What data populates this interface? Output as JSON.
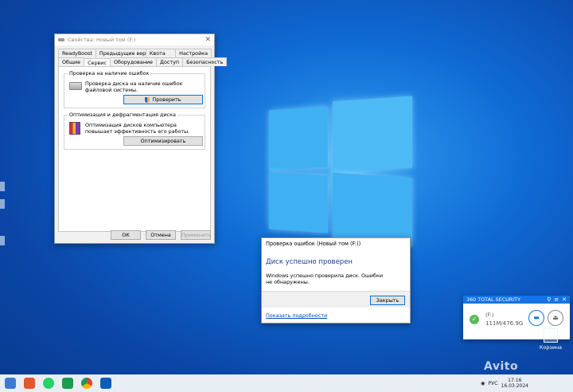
{
  "properties_window": {
    "title": "Свойства: Новый том (F:)",
    "tabs_row1": [
      "ReadyBoost",
      "Предыдущие версии",
      "Квота",
      "Настройка"
    ],
    "tabs_row2": [
      "Общие",
      "Сервис",
      "Оборудование",
      "Доступ",
      "Безопасность"
    ],
    "active_tab": "Сервис",
    "error_check": {
      "legend": "Проверка на наличие ошибок",
      "text": "Проверка диска на наличие ошибок файловой системы.",
      "button": "Проверить"
    },
    "optimize": {
      "legend": "Оптимизация и дефрагментация диска",
      "text": "Оптимизация дисков компьютера повышает эффективность его работы.",
      "button": "Оптимизировать"
    },
    "footer": {
      "ok": "ОК",
      "cancel": "Отмена",
      "apply": "Применить"
    }
  },
  "check_dialog": {
    "title": "Проверка ошибок (Новый том (F:))",
    "heading": "Диск успешно проверен",
    "message": "Windows успешно проверила диск. Ошибки не обнаружены.",
    "close_button": "Закрыть",
    "details_link": "Показать подробности"
  },
  "security_widget": {
    "title": "360 TOTAL SECURITY",
    "drive": "(F:)",
    "usage": "111M/476.9G"
  },
  "desktop": {
    "recycle_bin_label": "Корзина"
  },
  "taskbar": {
    "language": "РУС",
    "time": "17:16",
    "date": "16.03.2024"
  },
  "watermark": "Avito"
}
